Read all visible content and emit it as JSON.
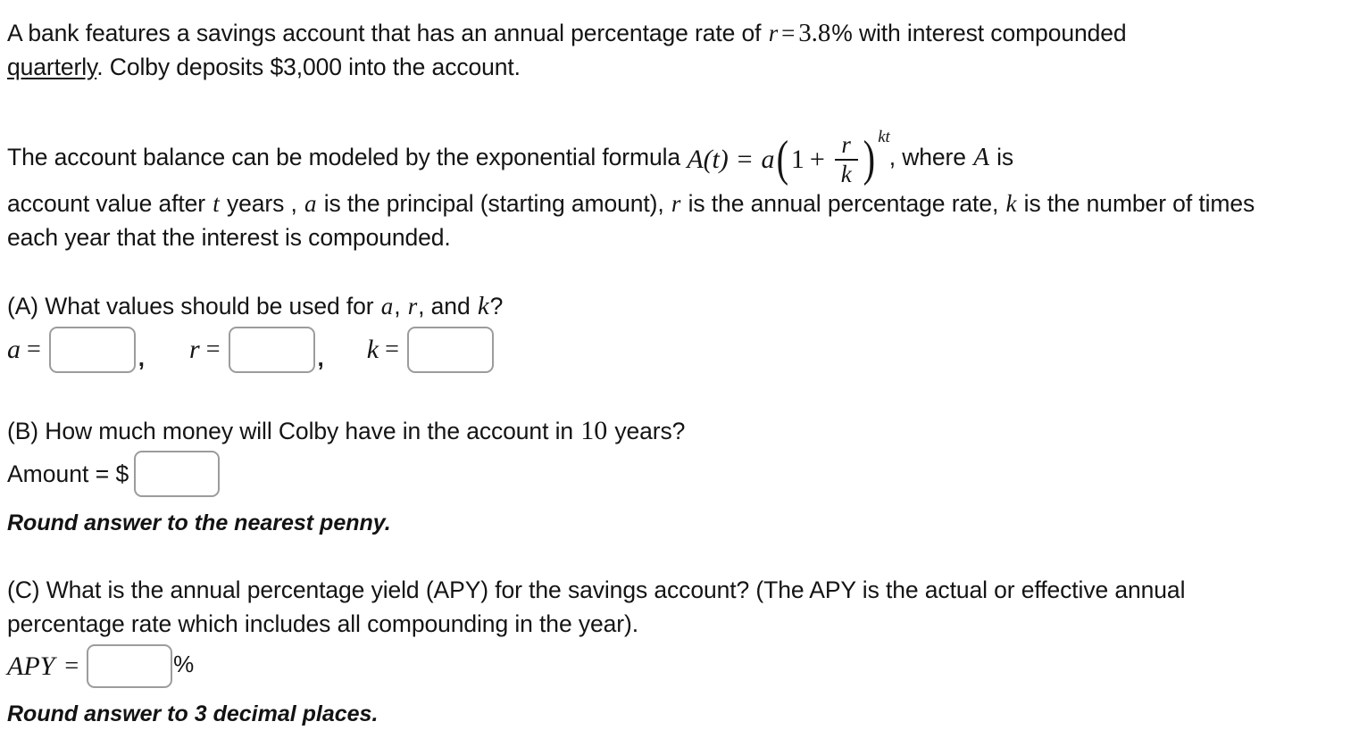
{
  "problem": {
    "intro": {
      "before_underline": "A bank features a savings account that has an annual percentage rate of ",
      "rate_var": "r",
      "rate_eq": "=",
      "rate_value": "3.8",
      "after_rate": "% with interest compounded ",
      "underlined_word": "quarterly",
      "after_underline": ". Colby deposits $3,000 into the account."
    },
    "model": {
      "lead": "The account balance can be modeled by the exponential formula ",
      "formula": {
        "function": "A",
        "open_paren": "(",
        "arg": "t",
        "close_paren": ")",
        "equals": "=",
        "coefficient": "a",
        "one": "1",
        "plus": "+",
        "numerator": "r",
        "denominator": "k",
        "exponent": "kt"
      },
      "after_formula": ", where ",
      "A_var": "A",
      "tail": " is"
    },
    "definitions": {
      "line1_a": "account value after ",
      "t_var": "t",
      "line1_b": " years , ",
      "a_var": "a",
      "line1_c": " is the principal (starting amount), ",
      "r_var": "r",
      "line1_d": " is the annual percentage rate, ",
      "k_var": "k",
      "line1_e": " is the",
      "line2": "number of times each year that the interest is compounded."
    }
  },
  "part_a": {
    "prompt_before": "(A) What values should be used for ",
    "var_a": "a",
    "sep1": ", ",
    "var_r": "r",
    "sep2": ", and ",
    "var_k": "k",
    "prompt_after": "?",
    "fields": [
      {
        "label": "a",
        "equals": "=",
        "value": "",
        "placeholder": "",
        "trailing": ","
      },
      {
        "label": "r",
        "equals": "=",
        "value": "",
        "placeholder": "",
        "trailing": ","
      },
      {
        "label": "k",
        "equals": "=",
        "value": "",
        "placeholder": "",
        "trailing": ""
      }
    ]
  },
  "part_b": {
    "prompt_before": "(B) How much money will Colby have in the account in ",
    "years": "10",
    "prompt_after": " years?",
    "answer_label": "Amount = $",
    "answer_value": "",
    "answer_placeholder": "",
    "note": "Round answer to the nearest penny."
  },
  "part_c": {
    "prompt_line1": "(C) What is the annual percentage yield (APY) for the savings account? (The APY is the actual or effective",
    "prompt_line2": "annual percentage rate which includes all compounding in the year).",
    "answer_label": "APY",
    "equals": "=",
    "answer_value": "",
    "answer_placeholder": "",
    "percent_symbol": "%",
    "note": "Round answer to 3 decimal places."
  },
  "style": {
    "background": "#ffffff",
    "text_color": "#141414",
    "input_border": "#9c9c9c"
  }
}
